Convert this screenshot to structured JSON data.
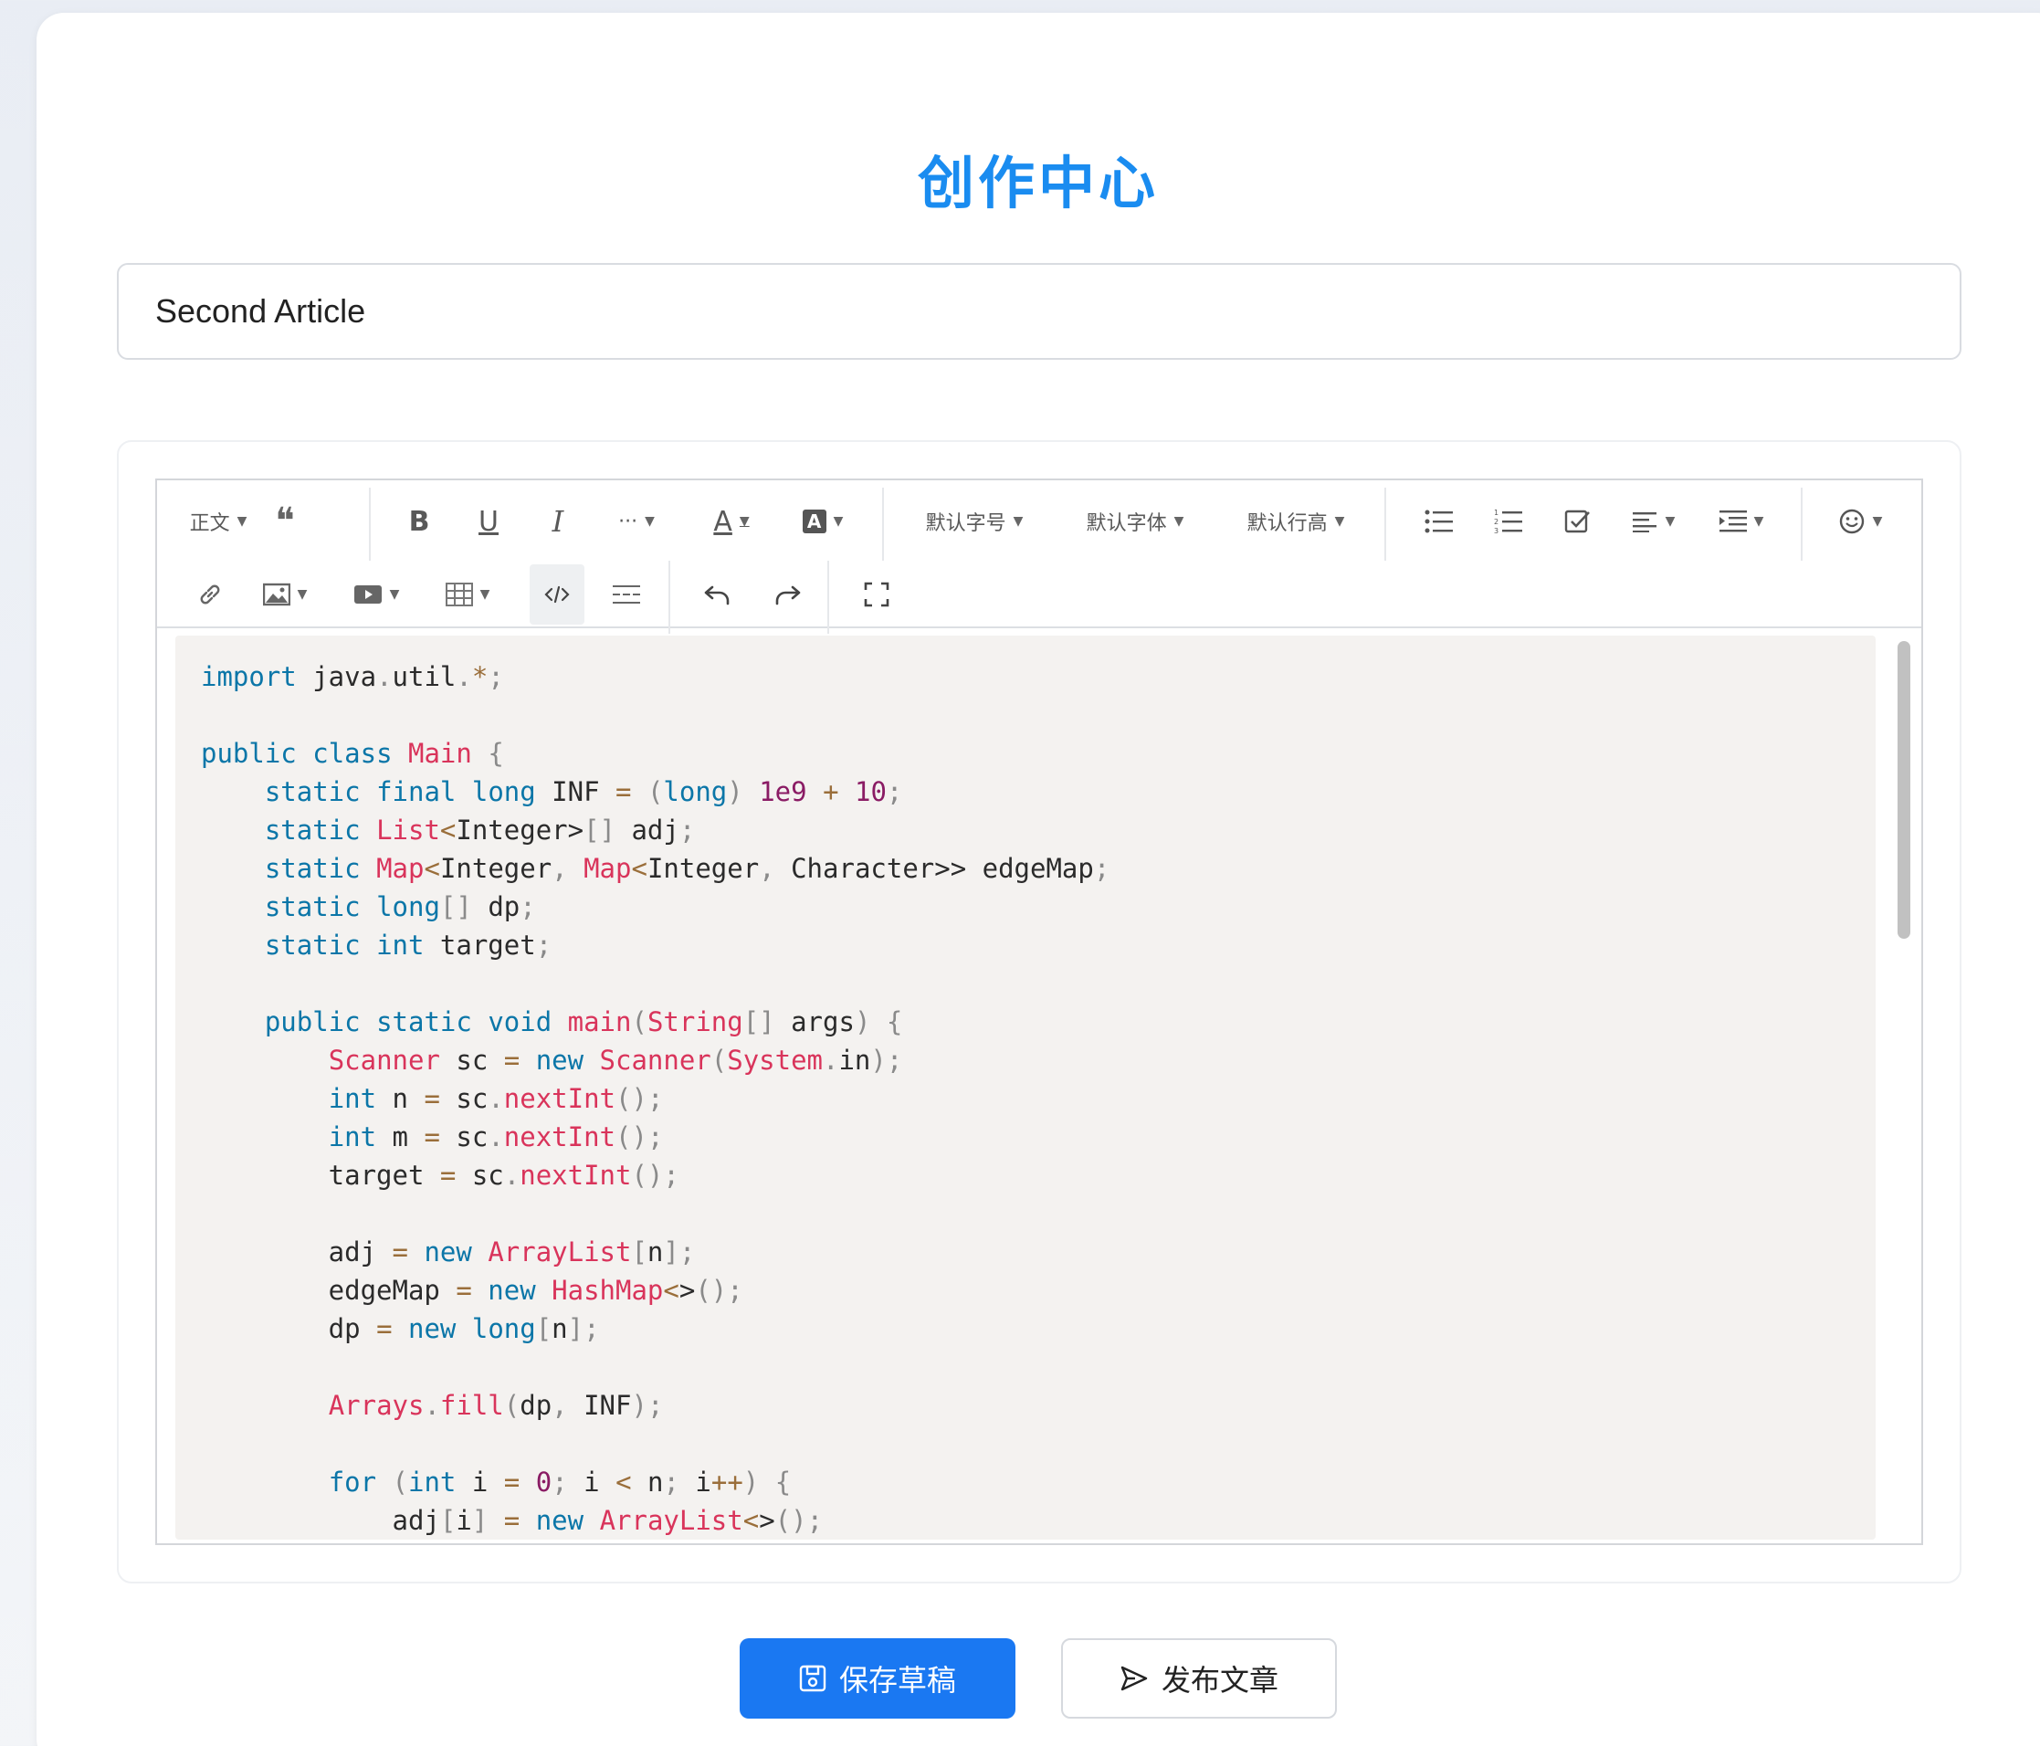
{
  "page": {
    "title": "创作中心"
  },
  "title_input": {
    "value": "Second Article",
    "placeholder": ""
  },
  "toolbar": {
    "row1": [
      {
        "name": "paragraph-style-dropdown",
        "label": "正文",
        "dropdown": true
      },
      {
        "name": "quote-icon",
        "label": "❝",
        "dropdown": false
      },
      {
        "name": "bold-icon",
        "label": "B",
        "dropdown": false
      },
      {
        "name": "underline-icon",
        "label": "U",
        "dropdown": false
      },
      {
        "name": "italic-icon",
        "label": "I",
        "dropdown": false
      },
      {
        "name": "more-text-styles-icon",
        "label": "···",
        "dropdown": true
      },
      {
        "name": "font-color-icon",
        "label": "A",
        "dropdown": true
      },
      {
        "name": "background-color-icon",
        "label": "A",
        "dropdown": true
      },
      {
        "name": "font-size-dropdown",
        "label": "默认字号",
        "dropdown": true
      },
      {
        "name": "font-family-dropdown",
        "label": "默认字体",
        "dropdown": true
      },
      {
        "name": "line-height-dropdown",
        "label": "默认行高",
        "dropdown": true
      },
      {
        "name": "bulleted-list-icon",
        "label": "",
        "dropdown": false
      },
      {
        "name": "numbered-list-icon",
        "label": "",
        "dropdown": false
      },
      {
        "name": "todo-checkbox-icon",
        "label": "",
        "dropdown": false
      },
      {
        "name": "align-icon",
        "label": "",
        "dropdown": true
      },
      {
        "name": "indent-icon",
        "label": "",
        "dropdown": true
      },
      {
        "name": "emoji-icon",
        "label": "",
        "dropdown": true
      }
    ],
    "row2": [
      {
        "name": "link-icon",
        "dropdown": false
      },
      {
        "name": "image-icon",
        "dropdown": true
      },
      {
        "name": "video-icon",
        "dropdown": true
      },
      {
        "name": "table-icon",
        "dropdown": true
      },
      {
        "name": "code-block-icon",
        "dropdown": false,
        "active": true
      },
      {
        "name": "divider-icon",
        "dropdown": false
      },
      {
        "name": "undo-icon",
        "dropdown": false
      },
      {
        "name": "redo-icon",
        "dropdown": false
      },
      {
        "name": "fullscreen-icon",
        "dropdown": false
      }
    ]
  },
  "code": {
    "language": "java",
    "lines": [
      "import java.util.*;",
      "",
      "public class Main {",
      "    static final long INF = (long) 1e9 + 10;",
      "    static List<Integer>[] adj;",
      "    static Map<Integer, Map<Integer, Character>> edgeMap;",
      "    static long[] dp;",
      "    static int target;",
      "",
      "    public static void main(String[] args) {",
      "        Scanner sc = new Scanner(System.in);",
      "        int n = sc.nextInt();",
      "        int m = sc.nextInt();",
      "        target = sc.nextInt();",
      "",
      "        adj = new ArrayList[n];",
      "        edgeMap = new HashMap<>();",
      "        dp = new long[n];",
      "",
      "        Arrays.fill(dp, INF);",
      "",
      "        for (int i = 0; i < n; i++) {",
      "            adj[i] = new ArrayList<>();"
    ]
  },
  "actions": {
    "save_label": "保存草稿",
    "publish_label": "发布文章"
  },
  "colors": {
    "accent": "#1a8cf0",
    "primary_button": "#1a78f2",
    "keyword": "#0b76a8",
    "type": "#d9345b",
    "number": "#8a1b64",
    "code_bg": "#f4f2f0"
  }
}
